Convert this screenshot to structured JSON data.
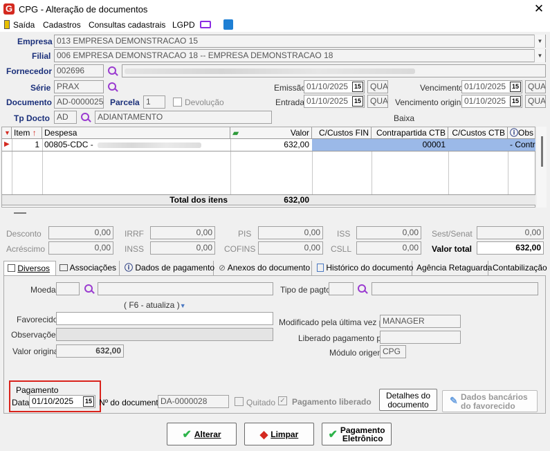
{
  "window": {
    "title": "CPG - Alteração de documentos",
    "close_glyph": "✕",
    "logo_letter": "G"
  },
  "menu": [
    "Saída",
    "Cadastros",
    "Consultas cadastrais",
    "LGPD"
  ],
  "header": {
    "empresa_label": "Empresa",
    "empresa_value": "013 EMPRESA DEMONSTRACAO 15",
    "filial_label": "Filial",
    "filial_value": "006 EMPRESA DEMONSTRACAO 18 -- EMPRESA DEMONSTRACAO 18",
    "fornecedor_label": "Fornecedor",
    "fornecedor_code": "002696",
    "serie_label": "Série",
    "serie_value": "PRAX",
    "documento_label": "Documento",
    "documento_value": "AD-0000025",
    "parcela_label": "Parcela",
    "parcela_value": "1",
    "devolucao_label": "Devolução",
    "tpdocto_label": "Tp Docto",
    "tpdocto_code": "AD",
    "tpdocto_desc": "ADIANTAMENTO",
    "emissao_label": "Emissão",
    "emissao_value": "01/10/2025",
    "emissao_day": "QUA",
    "entrada_label": "Entrada",
    "entrada_value": "01/10/2025",
    "entrada_day": "QUA",
    "vencimento_label": "Vencimento",
    "vencimento_value": "01/10/2025",
    "vencimento_day": "QUA",
    "venc_original_label": "Vencimento original",
    "venc_original_value": "01/10/2025",
    "venc_original_day": "QUA",
    "baixa_label": "Baixa",
    "calendar_glyph": "15"
  },
  "grid": {
    "columns": {
      "item": "Item",
      "despesa": "Despesa",
      "valor": "Valor",
      "ccfin": "C/Custos FIN",
      "contrapartida": "Contrapartida CTB",
      "ccctb": "C/Custos CTB",
      "obs": "Obs"
    },
    "row": {
      "item": "1",
      "despesa": "00805-CDC -",
      "valor": "632,00",
      "contrapartida": "00001",
      "obs": "- Contra"
    },
    "total_label": "Total dos itens",
    "total_value": "632,00"
  },
  "totals": {
    "desconto": {
      "label": "Desconto",
      "value": ""
    },
    "acrescimo": {
      "label": "Acréscimo",
      "value": "0,00"
    },
    "irrf": {
      "label": "IRRF",
      "value": "0,00"
    },
    "inss": {
      "label": "INSS",
      "value": "0,00"
    },
    "pis": {
      "label": "PIS",
      "value": "0,00"
    },
    "cofins": {
      "label": "COFINS",
      "value": "0,00"
    },
    "iss": {
      "label": "ISS",
      "value": "0,00"
    },
    "csll": {
      "label": "CSLL",
      "value": "0,00"
    },
    "sest": {
      "label": "Sest/Senat",
      "value": "0,00"
    },
    "valor_total": {
      "label": "Valor total",
      "value": "632,00"
    },
    "desconto_value": "0,00"
  },
  "tabs": [
    "Diversos",
    "Associações",
    "Dados de pagamento",
    "Anexos do documento",
    "Histórico do documento",
    "Agência Retaguarda",
    "Contabilização"
  ],
  "diversos": {
    "moeda_label": "Moeda",
    "f6_hint": "( F6 - atualiza )",
    "favorecido_label": "Favorecido",
    "observacoes_label": "Observações",
    "valor_original_label": "Valor original",
    "valor_original_value": "632,00",
    "tipo_pagto_label": "Tipo de pagto",
    "modificado_label": "Modificado pela última vez por",
    "modificado_value": "MANAGER",
    "liberado_label": "Liberado pagamento por",
    "modulo_label": "Módulo origem",
    "modulo_value": "CPG"
  },
  "pagamento": {
    "group_label": "Pagamento",
    "data_label": "Data",
    "data_value": "01/10/2025",
    "ndoc_label": "Nº do documento",
    "ndoc_value": "DA-0000028",
    "quitado_label": "Quitado",
    "liberado_label": "Pagamento liberado",
    "detalhes_label1": "Detalhes do",
    "detalhes_label2": "documento",
    "dados_bancarios1": "Dados bancários",
    "dados_bancarios2": "do favorecido"
  },
  "buttons": {
    "alterar": "Alterar",
    "limpar": "Limpar",
    "pag_line1": "Pagamento",
    "pag_line2": "Eletrônico"
  },
  "colors": {
    "accent_red": "#d42a20",
    "label_blue": "#1a2f7a",
    "selection": "#9bb9e8",
    "highlight_box": "#d9221b"
  }
}
